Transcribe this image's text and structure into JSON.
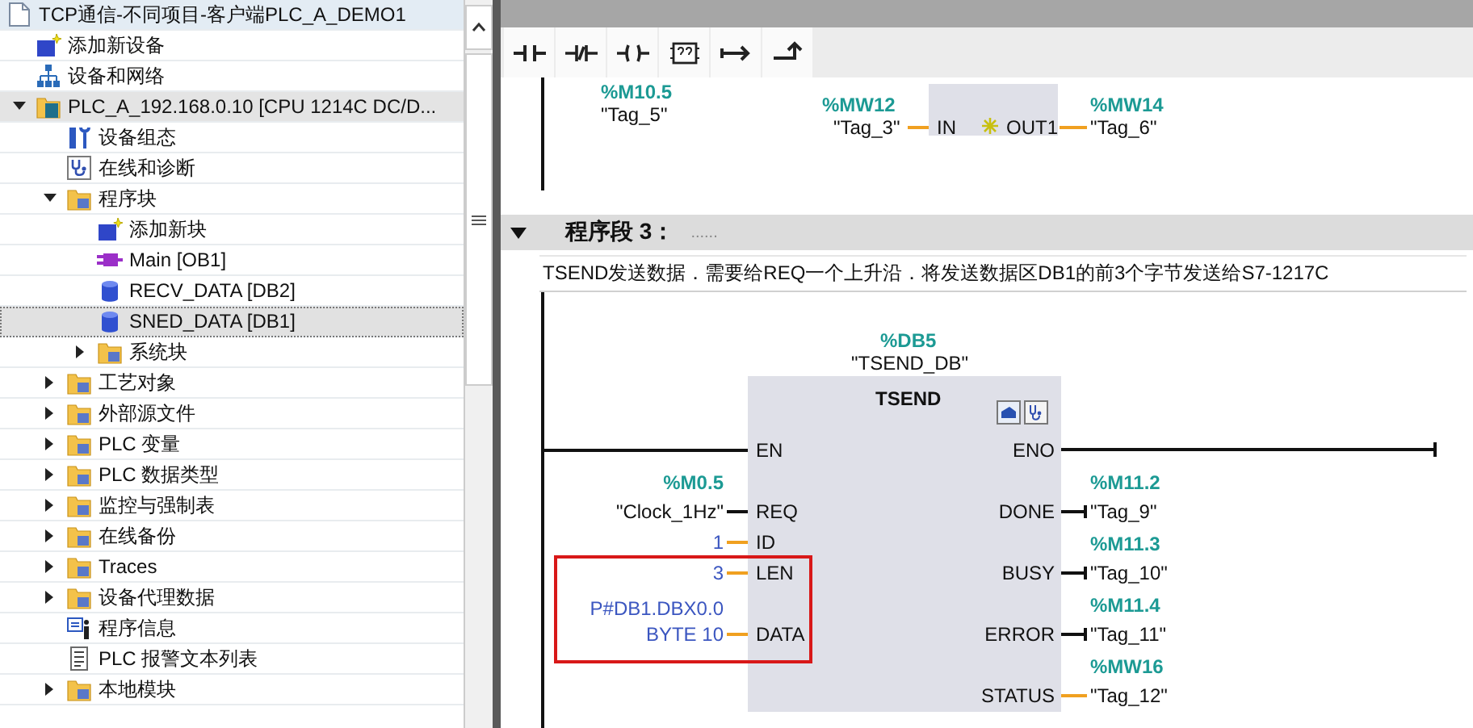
{
  "project_tree": {
    "items": [
      {
        "label": "TCP通信-不同项目-客户端PLC_A_DEMO1",
        "kind": "project",
        "selected": false,
        "children": [
          {
            "label": "添加新设备",
            "kind": "add-item",
            "selected": false
          },
          {
            "label": "设备和网络",
            "kind": "network",
            "selected": false
          },
          {
            "label": "PLC_A_192.168.0.10 [CPU 1214C DC/D...",
            "kind": "device",
            "selected": false,
            "expanded": true,
            "children": [
              {
                "label": "设备组态",
                "kind": "device-config",
                "selected": false
              },
              {
                "label": "在线和诊断",
                "kind": "diagnostics",
                "selected": false
              },
              {
                "label": "程序块",
                "kind": "folder",
                "selected": false,
                "expanded": true,
                "children": [
                  {
                    "label": "添加新块",
                    "kind": "add-item",
                    "selected": false
                  },
                  {
                    "label": "Main [OB1]",
                    "kind": "organization-block",
                    "selected": false
                  },
                  {
                    "label": "RECV_DATA [DB2]",
                    "kind": "data-block",
                    "selected": false
                  },
                  {
                    "label": "SNED_DATA [DB1]",
                    "kind": "data-block",
                    "selected": true
                  },
                  {
                    "label": "系统块",
                    "kind": "folder",
                    "selected": false,
                    "expanded": false
                  }
                ]
              },
              {
                "label": "工艺对象",
                "kind": "folder",
                "selected": false,
                "expanded": false
              },
              {
                "label": "外部源文件",
                "kind": "folder",
                "selected": false,
                "expanded": false
              },
              {
                "label": "PLC 变量",
                "kind": "folder",
                "selected": false,
                "expanded": false
              },
              {
                "label": "PLC 数据类型",
                "kind": "folder",
                "selected": false,
                "expanded": false
              },
              {
                "label": "监控与强制表",
                "kind": "folder",
                "selected": false,
                "expanded": false
              },
              {
                "label": "在线备份",
                "kind": "folder",
                "selected": false,
                "expanded": false
              },
              {
                "label": "Traces",
                "kind": "folder",
                "selected": false,
                "expanded": false
              },
              {
                "label": "设备代理数据",
                "kind": "folder",
                "selected": false,
                "expanded": false
              },
              {
                "label": "程序信息",
                "kind": "info",
                "selected": false
              },
              {
                "label": "PLC 报警文本列表",
                "kind": "text-list",
                "selected": false
              },
              {
                "label": "本地模块",
                "kind": "folder",
                "selected": false,
                "expanded": false
              }
            ]
          }
        ]
      }
    ]
  },
  "network_2": {
    "contact": {
      "address": "%M10.5",
      "operand": "\"Tag_5\""
    },
    "move_box": {
      "in_pin": "IN",
      "out_pin": "OUT1",
      "in_address": "%MW12",
      "in_operand": "\"Tag_3\"",
      "out_address": "%MW14",
      "out_operand": "\"Tag_6\""
    }
  },
  "network_3": {
    "expanded": true,
    "title": "程序段 3：",
    "title_placeholder": "......",
    "comment": "TSEND发送数据．需要给REQ一个上升沿．将发送数据区DB1的前3个字节发送给S7-1217C",
    "block": {
      "instance_address": "%DB5",
      "instance_name": "\"TSEND_DB\"",
      "type": "TSEND",
      "inputs": [
        {
          "pin": "EN",
          "kind": "power",
          "highlighted": false
        },
        {
          "pin": "REQ",
          "kind": "bool",
          "address": "%M0.5",
          "operand_lines": [
            "\"Clock_1Hz\""
          ],
          "highlighted": false
        },
        {
          "pin": "ID",
          "kind": "constant",
          "operand_lines": [
            "1"
          ],
          "highlighted": false
        },
        {
          "pin": "LEN",
          "kind": "constant",
          "operand_lines": [
            "3"
          ],
          "highlighted": true
        },
        {
          "pin": "DATA",
          "kind": "constant",
          "operand_lines": [
            "P#DB1.DBX0.0",
            "BYTE 10"
          ],
          "highlighted": true
        }
      ],
      "outputs": [
        {
          "pin": "ENO",
          "kind": "power"
        },
        {
          "pin": "DONE",
          "kind": "bool",
          "address": "%M11.2",
          "operand": "\"Tag_9\""
        },
        {
          "pin": "BUSY",
          "kind": "bool",
          "address": "%M11.3",
          "operand": "\"Tag_10\""
        },
        {
          "pin": "ERROR",
          "kind": "bool",
          "address": "%M11.4",
          "operand": "\"Tag_11\""
        },
        {
          "pin": "STATUS",
          "kind": "word",
          "address": "%MW16",
          "operand": "\"Tag_12\""
        }
      ]
    }
  }
}
